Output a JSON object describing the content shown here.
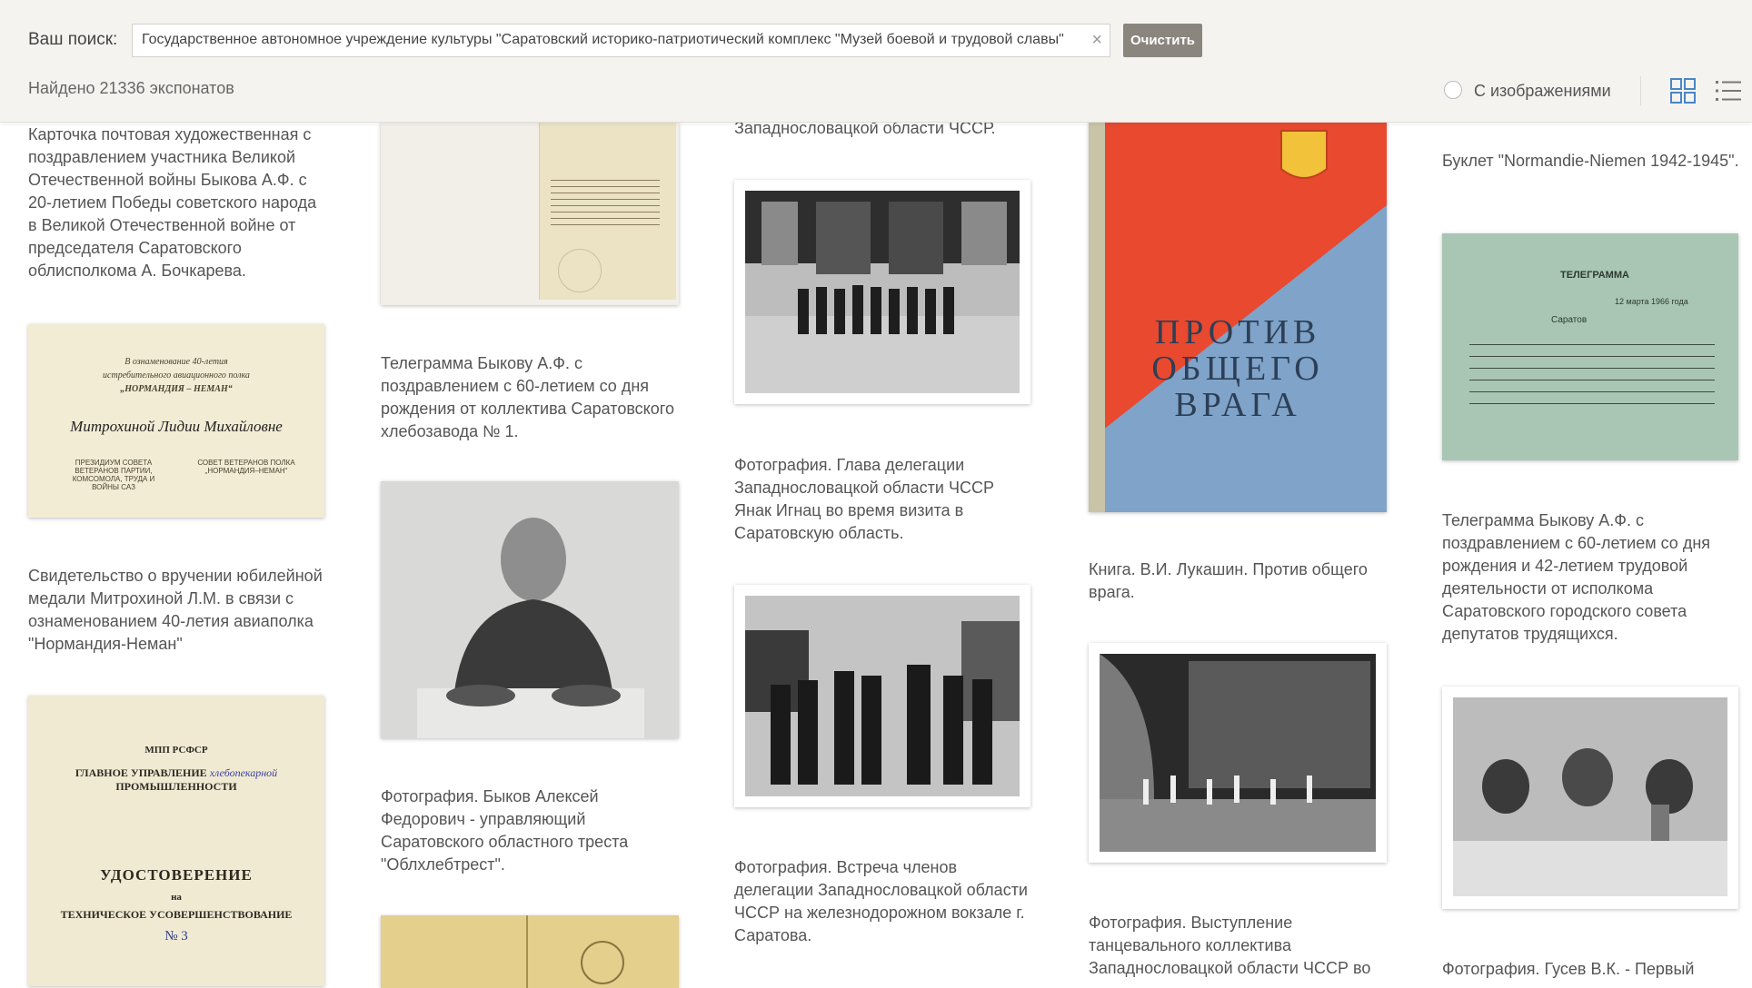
{
  "header": {
    "search_label": "Ваш поиск:",
    "search_value": "Государственное автономное учреждение культуры \"Саратовский историко-патриотический комплекс \"Музей боевой и трудовой славы\"",
    "clear_x": "×",
    "clear_button": "Очистить",
    "found_text": "Найдено 21336 экспонатов",
    "with_images_label": "С изображениями"
  },
  "cards": {
    "c1_1": "Карточка почтовая художественная с поздравлением участника Великой Отечественной войны Быкова А.Ф. с 20-летием Победы советского народа в Великой Отечественной войне от председателя Саратовского облисполкома А. Бочкарева.",
    "c1_2": "Свидетельство о вручении юбилейной медали Митрохиной Л.М. в связи с ознаменованием 40-летия авиаполка \"Нормандия-Неман\"",
    "c2_1": "Телеграмма Быкову А.Ф. с поздравлением с 60-летием со дня рождения от коллектива Саратовского хлебозавода № 1.",
    "c2_2": "Фотография. Быков Алексей Федорович - управляющий Саратовского областного треста \"Облхлебтрест\".",
    "c3_0": "Западнословацкой области ЧССР.",
    "c3_1": "Фотография. Глава делегации Западнословацкой области ЧССР Янак Игнац во время визита в Саратовскую область.",
    "c3_2": "Фотография. Встреча членов делегации Западнословацкой области ЧССР на железнодорожном вокзале г. Саратова.",
    "c4_1": "Книга. В.И. Лукашин. Против общего врага.",
    "c4_2": "Фотография. Выступление танцевального коллектива Западнословацкой области ЧССР во",
    "c5_1": "Буклет \"Normandie-Niemen 1942-1945\".",
    "c5_2": "Телеграмма Быкову А.Ф. с поздравлением с 60-летием со дня рождения и 42-летием трудовой деятельности от исполкома Саратовского городского совета депутатов трудящихся.",
    "c5_3": "Фотография. Гусев В.К. - Первый"
  },
  "thumbs": {
    "cert_line1": "В ознаменование 40-летия",
    "cert_line2": "истребительного авиационного полка",
    "cert_line3": "„НОРМАНДИЯ – НЕМАН“",
    "cert_name": "Митрохиной Лидии Михайловне",
    "cert_sign_left": "ПРЕЗИДИУМ СОВЕТА ВЕТЕРАНОВ ПАРТИИ, КОМСОМОЛА, ТРУДА И ВОЙНЫ САЗ",
    "cert_sign_right": "СОВЕТ ВЕТЕРАНОВ ПОЛКА „НОРМАНДИЯ–НЕМАН“",
    "doc_ministry": "МПП РСФСР",
    "doc_dept1": "ГЛАВНОЕ УПРАВЛЕНИЕ",
    "doc_dept_hand": "хлебопекарной",
    "doc_dept2": "ПРОМЫШЛЕННОСТИ",
    "doc_title": "УДОСТОВЕРЕНИЕ",
    "doc_na": "на",
    "doc_sub": "ТЕХНИЧЕСКОЕ УСОВЕРШЕНСТВОВАНИЕ",
    "doc_num": "№ 3",
    "book_line1": "ПРОТИВ",
    "book_line2": "ОБЩЕГО",
    "book_line3": "ВРАГА",
    "tele_title": "ТЕЛЕГРАММА",
    "tele_city": "Саратов",
    "tele_date": "12 марта 1966 года"
  },
  "colors": {
    "header_bg": "#f4f3f0",
    "clear_button_bg": "#8a857d",
    "book_red": "#e8492f",
    "book_blue": "#7fa3c9",
    "telegram_green": "#a9c6b4",
    "icon_blue": "#4a86c5"
  }
}
